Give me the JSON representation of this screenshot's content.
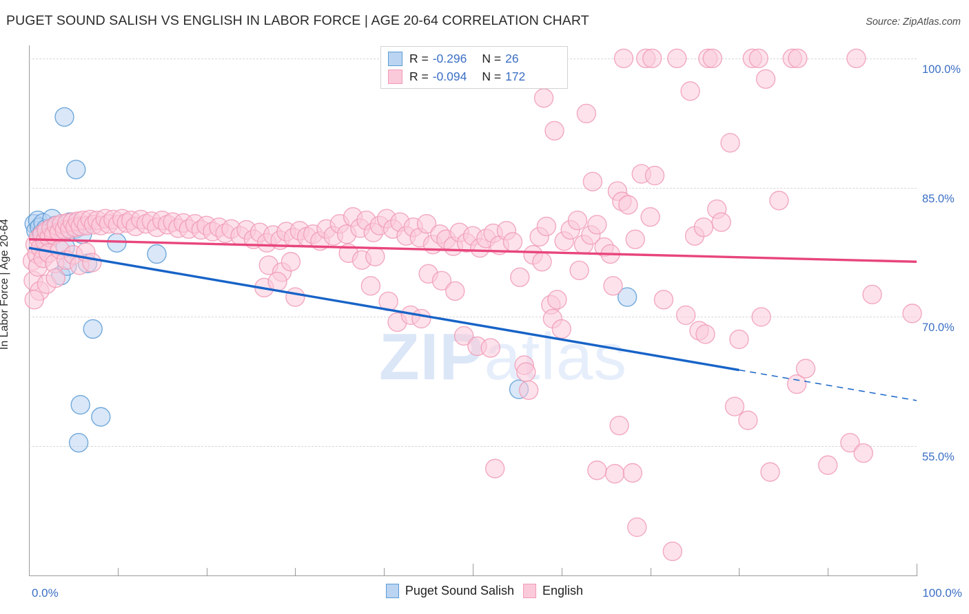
{
  "header": {
    "title": "PUGET SOUND SALISH VS ENGLISH IN LABOR FORCE | AGE 20-64 CORRELATION CHART",
    "source": "Source: ZipAtlas.com"
  },
  "watermark": {
    "bold": "ZIP",
    "light": "atlas"
  },
  "stats_legend": {
    "rows": [
      {
        "series": "Puget Sound Salish",
        "r_label": "R =",
        "r_value": "-0.296",
        "n_label": "N =",
        "n_value": "26",
        "color": "#bad4f2",
        "border": "#5b9bd5"
      },
      {
        "series": "English",
        "r_label": "R =",
        "r_value": "-0.094",
        "n_label": "N =",
        "n_value": "172",
        "color": "#fbcada",
        "border": "#f09bb6"
      }
    ]
  },
  "bottom_legend": {
    "items": [
      {
        "label": "Puget Sound Salish",
        "color": "#bad4f2",
        "border": "#5b9bd5"
      },
      {
        "label": "English",
        "color": "#fbcada",
        "border": "#f09bb6"
      }
    ]
  },
  "chart_data": {
    "type": "scatter",
    "title": "PUGET SOUND SALISH VS ENGLISH IN LABOR FORCE | AGE 20-64 CORRELATION CHART",
    "xlabel": "",
    "ylabel": "In Labor Force | Age 20-64",
    "xlim": [
      0,
      100
    ],
    "ylim": [
      40.0,
      101.5
    ],
    "grid": true,
    "xticklabels": [
      "0.0%",
      "100.0%"
    ],
    "yticklabels": [
      "100.0%",
      "85.0%",
      "70.0%",
      "55.0%"
    ],
    "ytickvalues": [
      100.0,
      85.0,
      70.0,
      55.0
    ],
    "xtickvalues": [
      0,
      10,
      20,
      30,
      40,
      50,
      60,
      70,
      80,
      90,
      100
    ],
    "legend_position": "bottom",
    "series": [
      {
        "name": "Puget Sound Salish",
        "color": "#bad4f2",
        "border": "#5b9bd5",
        "r": -0.296,
        "n": 26,
        "trend": {
          "x0": 0,
          "y0": 78.0,
          "x1": 100,
          "y1": 60.3,
          "solid_until_x": 80
        },
        "points": [
          [
            0.6,
            80.8
          ],
          [
            0.8,
            80.0
          ],
          [
            1.0,
            81.2
          ],
          [
            1.2,
            80.4
          ],
          [
            1.4,
            79.6
          ],
          [
            1.6,
            80.9
          ],
          [
            1.9,
            80.2
          ],
          [
            2.2,
            79.3
          ],
          [
            2.6,
            81.4
          ],
          [
            3.0,
            80.6
          ],
          [
            3.4,
            79.9
          ],
          [
            4.1,
            78.1
          ],
          [
            4.6,
            81.0
          ],
          [
            5.2,
            80.2
          ],
          [
            6.0,
            79.6
          ],
          [
            4.0,
            93.2
          ],
          [
            5.3,
            87.1
          ],
          [
            3.6,
            74.8
          ],
          [
            4.3,
            75.9
          ],
          [
            6.6,
            76.2
          ],
          [
            7.2,
            68.6
          ],
          [
            9.9,
            78.6
          ],
          [
            14.4,
            77.3
          ],
          [
            5.8,
            59.8
          ],
          [
            8.1,
            58.4
          ],
          [
            5.6,
            55.4
          ],
          [
            55.2,
            61.6
          ],
          [
            67.4,
            72.3
          ]
        ]
      },
      {
        "name": "English",
        "color": "#fbcada",
        "border": "#f09bb6",
        "r": -0.094,
        "n": 172,
        "trend": {
          "x0": 0,
          "y0": 79.0,
          "x1": 100,
          "y1": 76.4,
          "solid_until_x": 100
        },
        "points": [
          [
            0.4,
            76.5
          ],
          [
            0.5,
            74.2
          ],
          [
            0.7,
            78.4
          ],
          [
            0.9,
            77.3
          ],
          [
            1.1,
            79.1
          ],
          [
            1.3,
            78.0
          ],
          [
            1.5,
            79.6
          ],
          [
            1.8,
            78.8
          ],
          [
            2.0,
            80.0
          ],
          [
            2.3,
            79.2
          ],
          [
            2.5,
            80.3
          ],
          [
            2.8,
            79.5
          ],
          [
            3.1,
            80.6
          ],
          [
            3.4,
            79.8
          ],
          [
            3.7,
            80.8
          ],
          [
            4.0,
            80.1
          ],
          [
            4.3,
            80.9
          ],
          [
            4.6,
            80.2
          ],
          [
            4.9,
            81.0
          ],
          [
            5.2,
            80.4
          ],
          [
            5.5,
            81.1
          ],
          [
            5.8,
            80.5
          ],
          [
            6.1,
            81.2
          ],
          [
            6.5,
            80.6
          ],
          [
            6.9,
            81.3
          ],
          [
            7.3,
            80.7
          ],
          [
            7.7,
            81.2
          ],
          [
            8.1,
            80.6
          ],
          [
            8.6,
            81.4
          ],
          [
            9.0,
            80.8
          ],
          [
            9.5,
            81.3
          ],
          [
            10.0,
            80.7
          ],
          [
            10.5,
            81.4
          ],
          [
            11.0,
            80.9
          ],
          [
            11.5,
            81.2
          ],
          [
            12.0,
            80.5
          ],
          [
            12.6,
            81.3
          ],
          [
            13.2,
            80.8
          ],
          [
            13.8,
            81.1
          ],
          [
            14.4,
            80.4
          ],
          [
            15.0,
            81.2
          ],
          [
            15.6,
            80.7
          ],
          [
            16.2,
            81.0
          ],
          [
            16.8,
            80.3
          ],
          [
            17.4,
            80.9
          ],
          [
            18.0,
            80.2
          ],
          [
            18.7,
            80.8
          ],
          [
            19.4,
            80.1
          ],
          [
            20.0,
            80.6
          ],
          [
            20.7,
            79.9
          ],
          [
            21.4,
            80.4
          ],
          [
            22.1,
            79.7
          ],
          [
            22.8,
            80.2
          ],
          [
            1.0,
            75.8
          ],
          [
            1.6,
            76.8
          ],
          [
            2.2,
            77.4
          ],
          [
            2.9,
            76.2
          ],
          [
            3.5,
            77.8
          ],
          [
            4.2,
            76.6
          ],
          [
            5.0,
            77.2
          ],
          [
            5.7,
            76.0
          ],
          [
            6.4,
            77.5
          ],
          [
            7.1,
            76.3
          ],
          [
            1.2,
            73.0
          ],
          [
            2.0,
            73.8
          ],
          [
            3.0,
            74.5
          ],
          [
            0.6,
            72.0
          ],
          [
            23.8,
            79.4
          ],
          [
            24.5,
            80.1
          ],
          [
            25.3,
            79.0
          ],
          [
            26.0,
            79.8
          ],
          [
            26.8,
            78.6
          ],
          [
            27.5,
            79.5
          ],
          [
            28.3,
            78.9
          ],
          [
            29.0,
            79.9
          ],
          [
            29.8,
            79.2
          ],
          [
            30.5,
            80.0
          ],
          [
            31.3,
            79.3
          ],
          [
            27.0,
            76.0
          ],
          [
            28.5,
            75.2
          ],
          [
            29.5,
            76.4
          ],
          [
            32.0,
            79.6
          ],
          [
            32.8,
            78.8
          ],
          [
            33.5,
            80.2
          ],
          [
            34.3,
            79.4
          ],
          [
            26.5,
            73.4
          ],
          [
            28.0,
            74.1
          ],
          [
            30.0,
            72.3
          ],
          [
            35.0,
            80.8
          ],
          [
            35.8,
            79.6
          ],
          [
            36.5,
            81.6
          ],
          [
            37.3,
            80.3
          ],
          [
            38.0,
            81.2
          ],
          [
            38.8,
            79.8
          ],
          [
            39.5,
            80.6
          ],
          [
            40.3,
            81.4
          ],
          [
            41.0,
            80.2
          ],
          [
            41.8,
            81.0
          ],
          [
            42.5,
            79.4
          ],
          [
            36.0,
            77.4
          ],
          [
            37.5,
            76.6
          ],
          [
            39.0,
            77.0
          ],
          [
            43.3,
            80.4
          ],
          [
            44.0,
            79.2
          ],
          [
            44.8,
            80.8
          ],
          [
            45.5,
            78.4
          ],
          [
            46.3,
            79.6
          ],
          [
            38.5,
            73.6
          ],
          [
            40.5,
            71.8
          ],
          [
            41.5,
            69.4
          ],
          [
            43.0,
            70.2
          ],
          [
            44.2,
            69.8
          ],
          [
            47.0,
            79.0
          ],
          [
            47.8,
            78.2
          ],
          [
            48.5,
            79.8
          ],
          [
            49.3,
            78.6
          ],
          [
            50.0,
            79.4
          ],
          [
            50.8,
            78.0
          ],
          [
            51.5,
            79.1
          ],
          [
            45.0,
            75.0
          ],
          [
            46.5,
            74.2
          ],
          [
            48.0,
            73.0
          ],
          [
            49.0,
            67.8
          ],
          [
            50.5,
            66.6
          ],
          [
            52.0,
            66.4
          ],
          [
            52.3,
            79.7
          ],
          [
            53.0,
            78.3
          ],
          [
            53.8,
            80.0
          ],
          [
            54.5,
            78.7
          ],
          [
            55.3,
            74.6
          ],
          [
            55.8,
            64.4
          ],
          [
            56.0,
            63.6
          ],
          [
            56.3,
            61.5
          ],
          [
            57.5,
            79.3
          ],
          [
            58.3,
            80.5
          ],
          [
            56.8,
            77.2
          ],
          [
            57.8,
            76.4
          ],
          [
            58.8,
            71.4
          ],
          [
            59.5,
            72.0
          ],
          [
            60.3,
            78.8
          ],
          [
            61.0,
            80.1
          ],
          [
            61.8,
            81.2
          ],
          [
            62.5,
            78.4
          ],
          [
            59.0,
            69.8
          ],
          [
            60.0,
            68.6
          ],
          [
            62.0,
            75.4
          ],
          [
            63.3,
            79.5
          ],
          [
            64.0,
            80.7
          ],
          [
            64.8,
            78.1
          ],
          [
            65.5,
            77.3
          ],
          [
            58.0,
            95.4
          ],
          [
            59.2,
            91.6
          ],
          [
            62.8,
            93.6
          ],
          [
            63.5,
            85.7
          ],
          [
            66.3,
            84.6
          ],
          [
            66.8,
            83.4
          ],
          [
            67.5,
            83.0
          ],
          [
            68.3,
            79.0
          ],
          [
            65.8,
            73.6
          ],
          [
            66.5,
            57.4
          ],
          [
            69.0,
            86.6
          ],
          [
            70.5,
            86.4
          ],
          [
            67.0,
            100.0
          ],
          [
            69.5,
            100.0
          ],
          [
            70.2,
            100.0
          ],
          [
            73.0,
            100.0
          ],
          [
            76.5,
            100.0
          ],
          [
            77.0,
            100.0
          ],
          [
            81.5,
            100.0
          ],
          [
            82.2,
            100.0
          ],
          [
            86.0,
            100.0
          ],
          [
            86.6,
            100.0
          ],
          [
            93.2,
            100.0
          ],
          [
            74.5,
            96.2
          ],
          [
            83.0,
            97.6
          ],
          [
            70.0,
            81.6
          ],
          [
            75.0,
            79.4
          ],
          [
            76.0,
            80.4
          ],
          [
            77.5,
            82.5
          ],
          [
            78.0,
            81.0
          ],
          [
            79.0,
            90.2
          ],
          [
            71.5,
            72.0
          ],
          [
            74.0,
            70.2
          ],
          [
            75.5,
            68.4
          ],
          [
            76.2,
            68.0
          ],
          [
            79.5,
            59.6
          ],
          [
            81.0,
            58.0
          ],
          [
            80.0,
            67.4
          ],
          [
            82.5,
            70.0
          ],
          [
            84.5,
            83.5
          ],
          [
            86.5,
            62.2
          ],
          [
            87.5,
            64.0
          ],
          [
            83.5,
            52.0
          ],
          [
            90.0,
            52.8
          ],
          [
            95.0,
            72.6
          ],
          [
            99.5,
            70.4
          ],
          [
            92.5,
            55.4
          ],
          [
            94.0,
            54.2
          ],
          [
            64.0,
            52.2
          ],
          [
            66.0,
            51.8
          ],
          [
            68.0,
            51.9
          ],
          [
            52.5,
            52.4
          ],
          [
            68.5,
            45.6
          ],
          [
            72.5,
            42.8
          ]
        ]
      }
    ]
  }
}
